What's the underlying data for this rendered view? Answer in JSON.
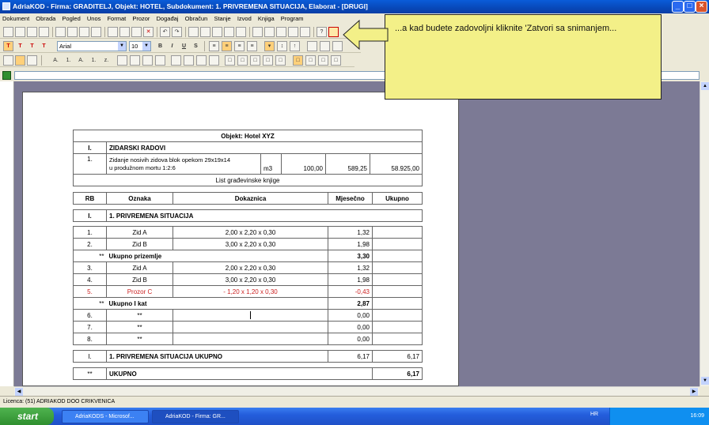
{
  "window": {
    "title": "AdriaKOD - Firma: GRADITELJ,  Objekt: HOTEL,  Subdokument: 1. PRIVREMENA SITUACIJA,  Elaborat - [DRUGI]"
  },
  "menu": [
    "Dokument",
    "Obrada",
    "Pogled",
    "Unos",
    "Format",
    "Prozor",
    "Događaj",
    "Obračun",
    "Stanje",
    "Izvod",
    "Knjiga",
    "Program"
  ],
  "font": {
    "name": "Arial",
    "size": "10"
  },
  "format_buttons": {
    "bold": "B",
    "italic": "I",
    "underline": "U",
    "strike": "S"
  },
  "style_buttons": [
    "T",
    "T",
    "T",
    "T"
  ],
  "list_buttons": [
    "A.",
    "1.",
    "A.",
    "1.",
    "z."
  ],
  "callout": "...a kad budete zadovoljni kliknite 'Zatvori sa snimanjem...",
  "doc": {
    "object_title": "Objekt: Hotel XYZ",
    "section": {
      "num": "I.",
      "name": "ZIDARSKI RADOVI"
    },
    "item": {
      "num": "1.",
      "desc1": "Zidanje nosivih zidova blok opekom 29x19x14",
      "desc2": "u produžnom mortu 1:2:6",
      "unit": "m3",
      "qty": "100,00",
      "price": "589,25",
      "total": "58.925,00"
    },
    "list_label": "List građevinske knjige",
    "headers": {
      "rb": "RB",
      "oznaka": "Oznaka",
      "dokaznica": "Dokaznica",
      "mjesecno": "Mjesečno",
      "ukupno": "Ukupno"
    },
    "situation": {
      "num": "I.",
      "name": "1. PRIVREMENA SITUACIJA"
    },
    "rows": [
      {
        "rb": "1.",
        "oznaka": "Zid A",
        "dok": "2,00 x 2,20 x 0,30",
        "mj": "1,32"
      },
      {
        "rb": "2.",
        "oznaka": "Zid B",
        "dok": "3,00 x 2,20 x 0,30",
        "mj": "1,98"
      },
      {
        "rb": "**",
        "oznaka": "Ukupno prizemlje",
        "dok": "",
        "mj": "3,30"
      },
      {
        "rb": "3.",
        "oznaka": "Zid A",
        "dok": "2,00 x 2,20 x 0,30",
        "mj": "1,32"
      },
      {
        "rb": "4.",
        "oznaka": "Zid B",
        "dok": "3,00 x 2,20 x 0,30",
        "mj": "1,98"
      },
      {
        "rb": "5.",
        "oznaka": "Prozor C",
        "dok": "- 1,20 x 1,20 x 0,30",
        "mj": "-0,43"
      },
      {
        "rb": "**",
        "oznaka": "Ukupno I kat",
        "dok": "",
        "mj": "2,87"
      },
      {
        "rb": "6.",
        "oznaka": "**",
        "dok": "",
        "mj": "0,00"
      },
      {
        "rb": "7.",
        "oznaka": "**",
        "dok": "",
        "mj": "0,00"
      },
      {
        "rb": "8.",
        "oznaka": "**",
        "dok": "",
        "mj": "0,00"
      }
    ],
    "sit_total": {
      "num": "I.",
      "name": "1. PRIVREMENA SITUACIJA UKUPNO",
      "mj": "6,17",
      "uk": "6,17"
    },
    "grand_total": {
      "num": "**",
      "name": "UKUPNO",
      "uk": "6,17"
    }
  },
  "status": "Licenca: (51) ADRIAKOD DOO CRIKVENICA",
  "taskbar": {
    "start": "start",
    "tasks": [
      "AdriaKODS - Microsof...",
      "AdriaKOD - Firma: GR..."
    ],
    "lang": "HR",
    "time": "16:09"
  }
}
